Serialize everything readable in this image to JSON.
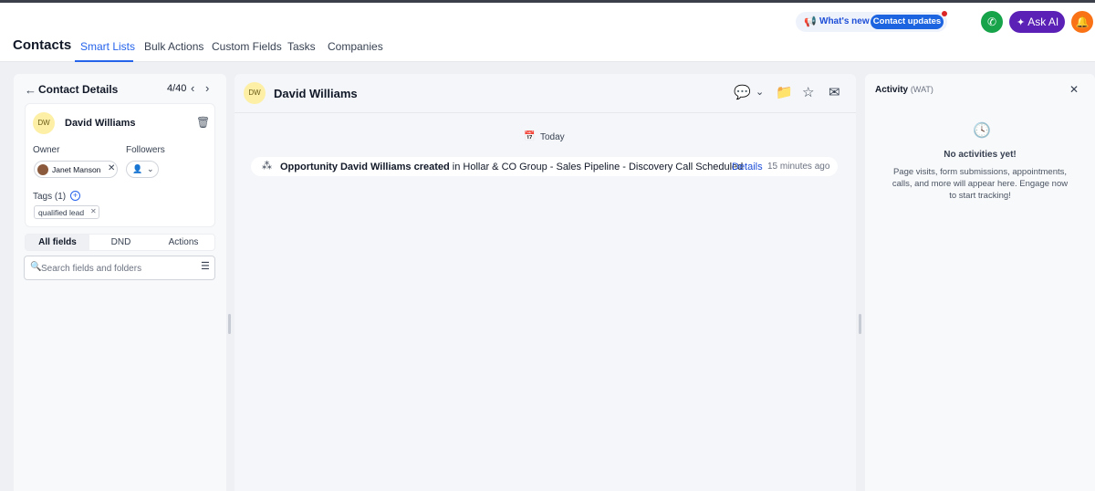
{
  "header": {
    "page_title": "Contacts",
    "tabs": [
      "Smart Lists",
      "Bulk Actions",
      "Custom Fields",
      "Tasks",
      "Companies"
    ],
    "active_tab": "Smart Lists",
    "whats_new_label": "What's new",
    "contact_updates_label": "Contact updates",
    "ask_ai_label": "Ask AI",
    "icons": {
      "announcement": "megaphone-icon",
      "phone": "phone-icon",
      "sparkle": "sparkle-icon",
      "notifications": "bell-icon"
    },
    "colors": {
      "accent": "#2563eb",
      "phone": "#16a34a",
      "ask_ai": "#5b21b6",
      "bell": "#f97316"
    }
  },
  "contact_details": {
    "title": "Contact Details",
    "position": "4/40",
    "contact": {
      "initials": "DW",
      "name": "David Williams"
    },
    "owner_label": "Owner",
    "owner_name": "Janet Manson",
    "followers_label": "Followers",
    "tags_label": "Tags (1)",
    "tags": [
      "qualified lead"
    ],
    "tabs": [
      "All fields",
      "DND",
      "Actions"
    ],
    "active_tab": "All fields",
    "search_placeholder": "Search fields and folders"
  },
  "timeline": {
    "contact_initials": "DW",
    "contact_name": "David Williams",
    "day_label": "Today",
    "event": {
      "title": "Opportunity David Williams created",
      "body": " in Hollar & CO Group - Sales Pipeline - Discovery Call Scheduled",
      "link": "Details",
      "time": "15 minutes ago"
    }
  },
  "activity": {
    "title": "Activity",
    "timezone": "(WAT)",
    "empty_title": "No activities yet!",
    "empty_desc": "Page visits, form submissions, appointments, calls, and more will appear here. Engage now to start tracking!"
  }
}
